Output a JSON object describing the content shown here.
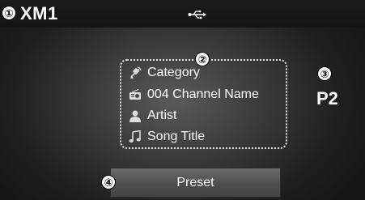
{
  "header": {
    "band": "XM1",
    "usb_icon": "usb-icon"
  },
  "callouts": [
    "①",
    "②",
    "③",
    "④"
  ],
  "info": {
    "category": {
      "icon": "satellite-icon",
      "text": "Category"
    },
    "channel": {
      "icon": "radio-icon",
      "text": "004 Channel Name"
    },
    "artist": {
      "icon": "person-icon",
      "text": "Artist"
    },
    "song": {
      "icon": "music-note-icon",
      "text": "Song Title"
    }
  },
  "preset_number": "P2",
  "preset_button": {
    "label": "Preset"
  },
  "colors": {
    "background": "#2e2e2e",
    "top_bar": "#161616",
    "text": "#ffffff",
    "dotted_border": "#e6e6e6",
    "button": "#5c5c5c"
  }
}
